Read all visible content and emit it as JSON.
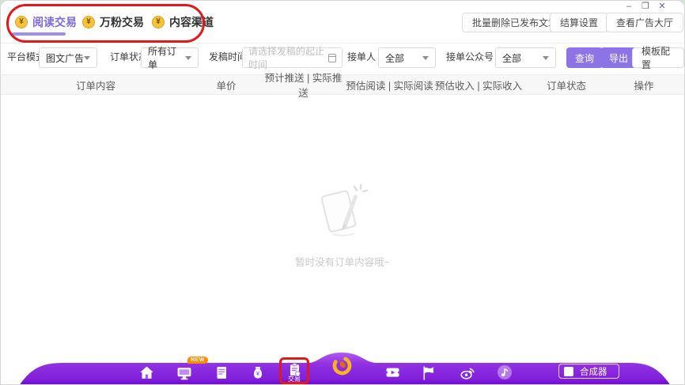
{
  "window": {
    "controls": {
      "minimize": "–",
      "maximize": "❐",
      "close": "✕"
    }
  },
  "tabs": [
    {
      "label": "阅读交易",
      "active": true
    },
    {
      "label": "万粉交易",
      "active": false
    },
    {
      "label": "内容渠道",
      "active": false
    }
  ],
  "coin_symbol": "¥",
  "header_actions": [
    {
      "label": "批量删除已发布文章"
    },
    {
      "label": "结算设置"
    },
    {
      "label": "查看广告大厅"
    }
  ],
  "filters": {
    "platform": {
      "label": "平台模式",
      "value": "图文广告"
    },
    "status": {
      "label": "订单状态",
      "value": "所有订单"
    },
    "time": {
      "label": "发稿时间",
      "placeholder": "请选择发稿的起止时间"
    },
    "receiver": {
      "label": "接单人",
      "value": "全部"
    },
    "account": {
      "label": "接单公众号",
      "value": "全部"
    },
    "query_button": "查询",
    "export_button": "导出",
    "template_button": "模板配置"
  },
  "table": {
    "columns": [
      "订单内容",
      "单价",
      "预计推送 | 实际推送",
      "预估阅读 | 实际阅读",
      "预估收入 | 实际收入",
      "订单状态",
      "操作"
    ]
  },
  "empty_state": {
    "message": "暂时没有订单内容哦~"
  },
  "dock": {
    "items": [
      {
        "icon": "home-icon"
      },
      {
        "icon": "monitor-icon",
        "badge": "NEW"
      },
      {
        "icon": "document-icon"
      },
      {
        "icon": "money-bag-icon"
      },
      {
        "icon": "clipboard-trade-icon",
        "label": "交易",
        "annotated": true
      },
      {
        "icon": "brand-swirl-logo"
      },
      {
        "icon": "ticket-icon"
      },
      {
        "icon": "flag-icon"
      },
      {
        "icon": "weibo-icon"
      },
      {
        "icon": "music-icon"
      }
    ],
    "synthesizer": {
      "label": "合成器",
      "checked": false
    }
  },
  "colors": {
    "accent_purple": "#8d74e6",
    "active_tab": "#7e68e2",
    "dock_gradient_top": "#a84fe9",
    "dock_gradient_bottom": "#6d05cd",
    "annotation_red": "#e01a1a",
    "coin_gold": "#f7c437",
    "badge_orange": "#ff8a00",
    "logo_gold": "#f6b51e",
    "logo_orange": "#e8680f"
  }
}
